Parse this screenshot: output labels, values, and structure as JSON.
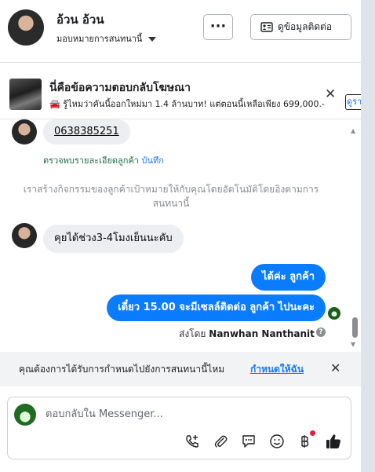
{
  "header": {
    "contact_name": "อ้วน อ้วน",
    "assign_label": "มอบหมายการสนทนานี้",
    "more_label": "···",
    "contact_info_button": "ดูข้อมูลติดต่อ"
  },
  "ad_banner": {
    "title": "นี่คือข้อความตอบกลับโฆษณา",
    "description": "🚘 รู้ไหมว่าคันนี้ออกใหม่มา 1.4 ล้านบาท! แต่ตอนนี้เหลือเพียง 699,000.-",
    "cut_button": "ดูรา"
  },
  "chat": {
    "phone_message": "0638385251",
    "verify_text": "ตรวจพบรายละเอียดลูกค้า",
    "verify_link": "บันทึก",
    "system_note": "เราสร้างกิจกรรมของลูกค้าเป้าหมายให้กับคุณโดยอัตโนมัติโดยอิงตามการสนทนานี้",
    "customer_message": "คุยได้ช่วง3-4โมงเย็นนะคับ",
    "outgoing": [
      "ได้ค่ะ  ลูกค้า",
      "เดี๋ยว 15.00 จะมีเซลล์ติดต่อ ลูกค้า ไปนะคะ"
    ],
    "sent_by_label": "ส่งโดย",
    "sent_by_name": "Nanwhan Nanthanit",
    "help_glyph": "?"
  },
  "assign_prompt": {
    "question": "คุณต้องการได้รับการกำหนดไปยังการสนทนานี้ไหม",
    "action": "กำหนดให้ฉัน"
  },
  "composer": {
    "placeholder": "ตอบกลับใน Messenger...",
    "tools": [
      "phone-add-icon",
      "attachment-icon",
      "saved-reply-icon",
      "emoji-icon",
      "payment-icon",
      "thumbs-up-icon"
    ]
  },
  "colors": {
    "accent": "#1877f2",
    "outgoing_bubble": "#0a7cff",
    "incoming_bubble": "#eceef1",
    "verify_green": "#1d6f45",
    "notification_red": "#e41e3f"
  }
}
